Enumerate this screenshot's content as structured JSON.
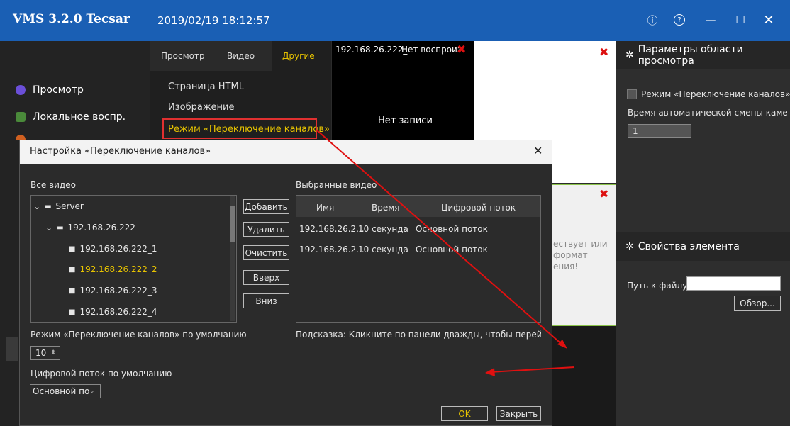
{
  "window": {
    "app_title": "VMS 3.2.0 Tecsar",
    "datetime": "2019/02/19 18:12:57",
    "buttons": {
      "info": "ⓘ",
      "help": "?",
      "minimize": "—",
      "maximize": "☐",
      "close": "✕"
    }
  },
  "sidebar": {
    "items": [
      {
        "label": "Просмотр",
        "icon": "view-icon"
      },
      {
        "label": "Локальное воспр.",
        "icon": "playback-icon"
      }
    ]
  },
  "menu": {
    "tabs": [
      "Просмотр",
      "Видео",
      "Другие"
    ],
    "items": [
      "Страница HTML",
      "Изображение",
      "Режим «Переключение каналов»"
    ],
    "active_tab": "Другие"
  },
  "tiles": {
    "tile1_ip": "192.168.26.222_",
    "tile1_status": "Нет воспроизве",
    "tile1_center": "Нет записи",
    "tile3_lines": [
      "ествует или",
      "формат",
      "ения!"
    ]
  },
  "right_panel": {
    "section1_title": "Параметры области просмотра",
    "switch_mode_label": "Режим «Переключение каналов»",
    "auto_switch_label": "Время автоматической смены камер",
    "auto_switch_value": "1",
    "section2_title": "Свойства элемента",
    "file_path_label": "Путь к файлу:",
    "file_path_value": "",
    "browse_button": "Обзор..."
  },
  "dialog": {
    "title": "Настройка «Переключение каналов»",
    "close": "✕",
    "all_videos_label": "Все видео",
    "selected_videos_label": "Выбранные видео",
    "tree": [
      {
        "label": "Server",
        "level": 0
      },
      {
        "label": "192.168.26.222",
        "level": 1
      },
      {
        "label": "192.168.26.222_1",
        "level": 2
      },
      {
        "label": "192.168.26.222_2",
        "level": 2,
        "selected": true
      },
      {
        "label": "192.168.26.222_3",
        "level": 2
      },
      {
        "label": "192.168.26.222_4",
        "level": 2
      }
    ],
    "buttons": {
      "add": "Добавить",
      "remove": "Удалить",
      "clear": "Очистить",
      "up": "Вверх",
      "down": "Вниз",
      "ok": "OK",
      "close": "Закрыть"
    },
    "table_columns": [
      "Имя",
      "Время",
      "Цифровой поток"
    ],
    "table_rows": [
      [
        "192.168.26.2...",
        "10 секунда",
        "Основной поток"
      ],
      [
        "192.168.26.2...",
        "10 секунда",
        "Основной поток"
      ]
    ],
    "default_mode_label": "Режим «Переключение каналов» по умолчанию",
    "default_mode_value": "10",
    "hint": "Подсказка: Кликните по панели дважды, чтобы перейти в р",
    "default_stream_label": "Цифровой поток по умолчанию",
    "default_stream_value": "Основной пот"
  },
  "colors": {
    "titlebar": "#1a5fb4",
    "highlight": "#e6c200",
    "annotation_red": "#e01010"
  }
}
